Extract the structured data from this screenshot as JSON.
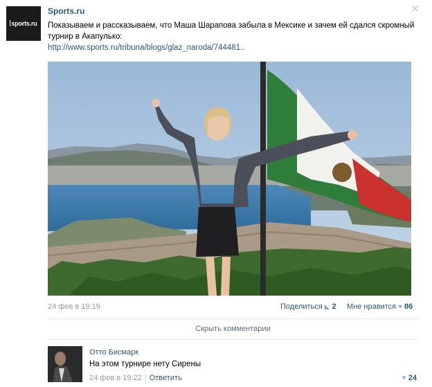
{
  "post": {
    "author": "Sports.ru",
    "avatar_text": "sports.ru",
    "text": "Показываем и рассказываем, что Маша Шарапова забыла в Мексике и зачем ей сдался скромный турнир в Акапулько:",
    "link": "http://www.sports.ru/tribuna/blogs/glaz_naroda/744481..",
    "date": "24 фев в 19:19",
    "share_label": "Поделиться",
    "share_count": "2",
    "like_label": "Мне нравится",
    "like_count": "86",
    "close_icon": "close-icon"
  },
  "comments_toggle": "Скрыть комментарии",
  "comment": {
    "author": "Отто Бисмарк",
    "text": "На этом турнире нету Сирены",
    "date": "24 фев в 19:22",
    "reply_label": "Ответить",
    "like_count": "24"
  },
  "colors": {
    "link": "#2b587a",
    "meta": "#999999"
  }
}
